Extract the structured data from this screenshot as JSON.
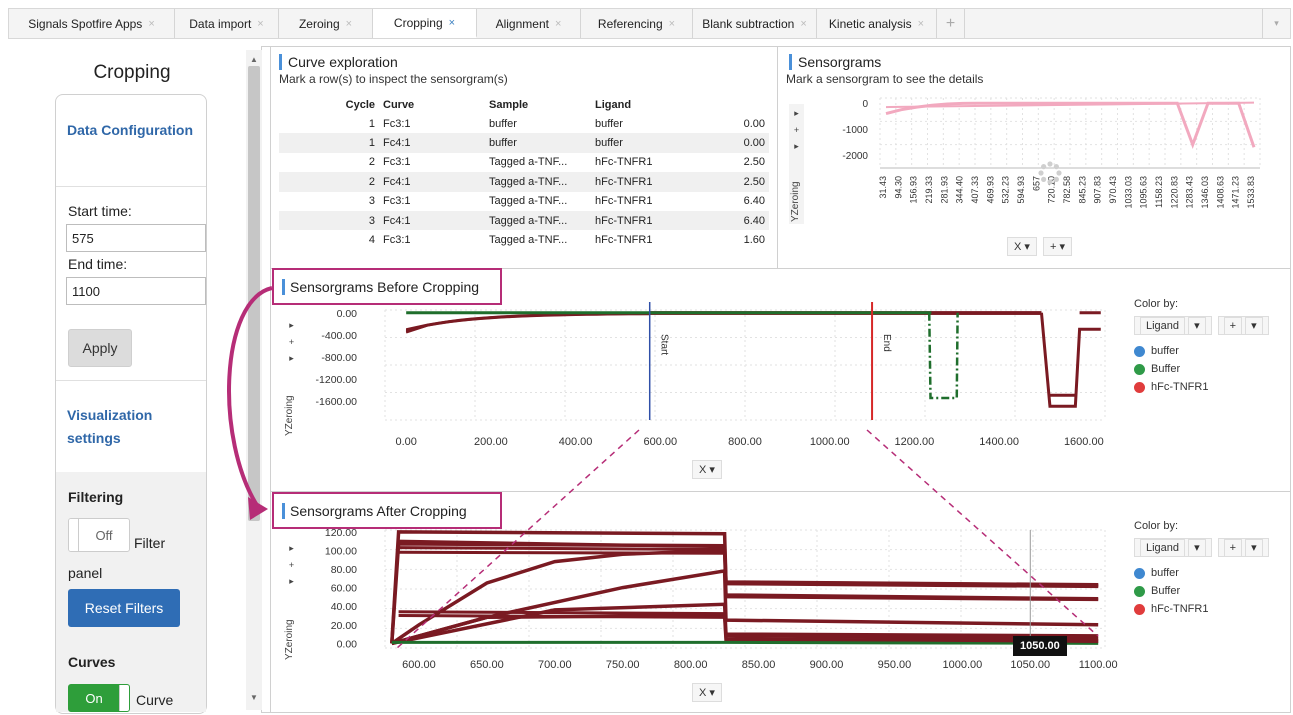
{
  "tabs": [
    {
      "label": "Signals Spotfire Apps",
      "closable": true,
      "active": false
    },
    {
      "label": "Data import",
      "closable": true,
      "active": false
    },
    {
      "label": "Zeroing",
      "closable": true,
      "active": false
    },
    {
      "label": "Cropping",
      "closable": true,
      "active": true
    },
    {
      "label": "Alignment",
      "closable": true,
      "active": false
    },
    {
      "label": "Referencing",
      "closable": true,
      "active": false
    },
    {
      "label": "Blank subtraction",
      "closable": true,
      "active": false
    },
    {
      "label": "Kinetic analysis",
      "closable": true,
      "active": false
    }
  ],
  "tab_close_glyph": "×",
  "tab_add_glyph": "+",
  "tab_menu_glyph": "▾",
  "sidebar": {
    "title": "Cropping",
    "data_config_label": "Data Configuration",
    "start_time_label": "Start time:",
    "start_time_value": "575",
    "end_time_label": "End time:",
    "end_time_value": "1100",
    "apply_label": "Apply",
    "visualization_label": "Visualization settings",
    "filtering_label": "Filtering",
    "filter_toggle_state": "Off",
    "filter_panel_label": "Filter panel",
    "reset_filters_label": "Reset Filters",
    "curves_label": "Curves",
    "curves_toggle_state": "On",
    "curve_label": "Curve"
  },
  "curve_exploration": {
    "title": "Curve exploration",
    "subtitle": "Mark a row(s) to inspect the sensorgram(s)",
    "columns": [
      "Cycle",
      "Curve",
      "Sample",
      "Ligand",
      ""
    ],
    "rows": [
      [
        "1",
        "Fc3:1",
        "buffer",
        "buffer",
        "0.00"
      ],
      [
        "1",
        "Fc4:1",
        "buffer",
        "buffer",
        "0.00"
      ],
      [
        "2",
        "Fc3:1",
        "Tagged a-TNF...",
        "hFc-TNFR1",
        "2.50"
      ],
      [
        "2",
        "Fc4:1",
        "Tagged a-TNF...",
        "hFc-TNFR1",
        "2.50"
      ],
      [
        "3",
        "Fc3:1",
        "Tagged a-TNF...",
        "hFc-TNFR1",
        "6.40"
      ],
      [
        "3",
        "Fc4:1",
        "Tagged a-TNF...",
        "hFc-TNFR1",
        "6.40"
      ],
      [
        "4",
        "Fc3:1",
        "Tagged a-TNF...",
        "hFc-TNFR1",
        "1.60"
      ]
    ]
  },
  "sensorgrams": {
    "title": "Sensorgrams",
    "subtitle": "Mark a sensorgram to see the details",
    "y_ticks": [
      "0",
      "-1000",
      "-2000"
    ],
    "x_ticks": [
      "31.43",
      "94.30",
      "156.93",
      "219.33",
      "281.93",
      "344.40",
      "407.33",
      "469.93",
      "532.23",
      "594.93",
      "657",
      "720.10",
      "782.58",
      "845.23",
      "907.83",
      "970.43",
      "1033.03",
      "1095.63",
      "1158.23",
      "1220.83",
      "1283.43",
      "1346.03",
      "1408.63",
      "1471.23",
      "1533.83"
    ],
    "x_axis_label": "X",
    "y_axis_label": "YZeroing"
  },
  "before_cropping": {
    "title": "Sensorgrams Before Cropping",
    "y_ticks": [
      "0.00",
      "-400.00",
      "-800.00",
      "-1200.00",
      "-1600.00"
    ],
    "x_ticks": [
      "0.00",
      "200.00",
      "400.00",
      "600.00",
      "800.00",
      "1000.00",
      "1200.00",
      "1400.00",
      "1600.00"
    ],
    "start_label": "Start",
    "end_label": "End",
    "x_axis_label": "X",
    "y_axis_label": "YZeroing"
  },
  "after_cropping": {
    "title": "Sensorgrams After Cropping",
    "y_ticks": [
      "120.00",
      "100.00",
      "80.00",
      "60.00",
      "40.00",
      "20.00",
      "0.00"
    ],
    "x_ticks": [
      "600.00",
      "650.00",
      "700.00",
      "750.00",
      "800.00",
      "850.00",
      "900.00",
      "950.00",
      "1000.00",
      "1050.00",
      "1100.00"
    ],
    "tooltip": "1050.00",
    "x_axis_label": "X",
    "y_axis_label": "YZeroing"
  },
  "legend": {
    "color_by_label": "Color by:",
    "color_by_value": "Ligand",
    "items": [
      {
        "label": "buffer",
        "color": "#3f88d0"
      },
      {
        "label": "Buffer",
        "color": "#2f9a48"
      },
      {
        "label": "hFc-TNFR1",
        "color": "#e03c3c"
      }
    ]
  },
  "colors": {
    "accent": "#4a90d9",
    "callout": "#b62d77",
    "series_dark_red": "#7a1a22",
    "series_green": "#1f6e2c",
    "series_pink": "#f2a9bf",
    "start_line": "#2f4fa8",
    "end_line": "#d62828",
    "primary_button": "#2f6db5"
  },
  "icons": {
    "control_right": "▸",
    "control_plus": "+",
    "dropdown": "▾"
  },
  "chart_data": [
    {
      "type": "line",
      "title": "Sensorgrams",
      "xlabel": "X",
      "ylabel": "YZeroing",
      "ylim": [
        -2500,
        200
      ],
      "x": [
        "31.43",
        "94.30",
        "156.93",
        "219.33",
        "281.93",
        "344.40",
        "407.33",
        "469.93",
        "532.23",
        "594.93",
        "657",
        "720.10",
        "782.58",
        "845.23",
        "907.83",
        "970.43",
        "1033.03",
        "1095.63",
        "1158.23",
        "1220.83",
        "1283.43",
        "1346.03",
        "1408.63",
        "1471.23",
        "1533.83"
      ],
      "series": [
        {
          "values": [
            -400,
            -250,
            -150,
            -80,
            -30,
            -10,
            0,
            0,
            0,
            0,
            0,
            0,
            0,
            0,
            0,
            0,
            0,
            0,
            0,
            0,
            -1600,
            0,
            0,
            0,
            -1700
          ]
        }
      ]
    },
    {
      "type": "line",
      "title": "Sensorgrams Before Cropping",
      "xlabel": "X",
      "ylabel": "YZeroing",
      "xlim": [
        -50,
        1650
      ],
      "ylim": [
        -1950,
        50
      ],
      "series": [
        {
          "name": "hFc-TNFR1",
          "x": [
            0,
            100,
            200,
            300,
            400,
            575,
            600,
            1100,
            1500,
            1520,
            1530,
            1580,
            1590,
            1600
          ],
          "y": [
            -300,
            -200,
            -120,
            -60,
            -20,
            0,
            0,
            0,
            0,
            -1700,
            -1700,
            -1700,
            -300,
            -300
          ]
        },
        {
          "name": "Buffer",
          "x": [
            0,
            200,
            575,
            1100,
            1240,
            1250,
            1300,
            1310,
            1600
          ],
          "y": [
            0,
            0,
            0,
            0,
            0,
            -1550,
            -1550,
            0,
            0
          ]
        }
      ],
      "markers": [
        {
          "label": "Start",
          "x": 575
        },
        {
          "label": "End",
          "x": 1100
        }
      ]
    },
    {
      "type": "line",
      "title": "Sensorgrams After Cropping",
      "xlabel": "X",
      "ylabel": "YZeroing",
      "xlim": [
        575,
        1105
      ],
      "ylim": [
        -5,
        122
      ],
      "series": [
        {
          "name": "hFc-TNFR1",
          "x": [
            580,
            585,
            825,
            826,
            1100
          ],
          "y": [
            0,
            120,
            118,
            65,
            62
          ]
        },
        {
          "name": "hFc-TNFR1",
          "x": [
            580,
            585,
            825,
            826,
            1100
          ],
          "y": [
            0,
            107,
            105,
            66,
            63
          ]
        },
        {
          "name": "hFc-TNFR1",
          "x": [
            580,
            600,
            650,
            700,
            750,
            825,
            826,
            1100
          ],
          "y": [
            0,
            20,
            65,
            88,
            96,
            100,
            52,
            48
          ]
        },
        {
          "name": "hFc-TNFR1",
          "x": [
            580,
            650,
            750,
            825,
            826,
            1100
          ],
          "y": [
            0,
            28,
            60,
            78,
            25,
            20
          ]
        },
        {
          "name": "hFc-TNFR1",
          "x": [
            580,
            700,
            825,
            826,
            1100
          ],
          "y": [
            0,
            36,
            42,
            10,
            8
          ]
        },
        {
          "name": "hFc-TNFR1",
          "x": [
            580,
            650,
            825,
            826,
            1100
          ],
          "y": [
            0,
            28,
            30,
            4,
            3
          ]
        },
        {
          "name": "Buffer",
          "x": [
            580,
            825,
            1100
          ],
          "y": [
            1,
            1,
            0
          ]
        }
      ],
      "annotations": [
        {
          "label": "1050.00",
          "x": 1050
        }
      ]
    }
  ]
}
